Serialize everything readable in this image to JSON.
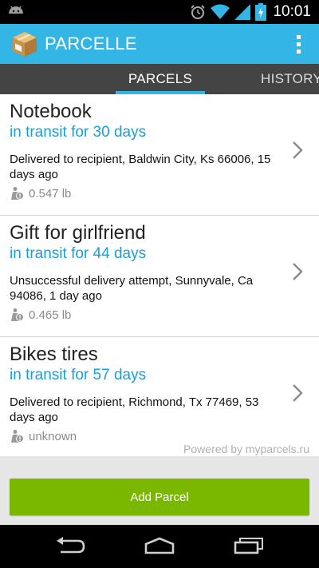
{
  "status_bar": {
    "time": "10:01",
    "icons": [
      "android-icon",
      "alarm-icon",
      "wifi-icon",
      "signal-icon",
      "battery-icon"
    ]
  },
  "action_bar": {
    "title": "PARCELLE",
    "logo_icon": "parcel-box-icon",
    "menu_icon": "overflow-menu-icon",
    "color": "#33b5e5"
  },
  "tabs": [
    {
      "label": "PARCELS",
      "selected": true
    },
    {
      "label": "HISTORY",
      "selected": false
    }
  ],
  "parcels": [
    {
      "name": "Notebook",
      "transit": "in transit for 30 days",
      "status": "Delivered to recipient, Baldwin City, Ks 66006, 15 days ago",
      "weight": "0.547 lb"
    },
    {
      "name": "Gift for girlfriend",
      "transit": "in transit for 44 days",
      "status": "Unsuccessful delivery attempt, Sunnyvale, Ca 94086, 1 day ago",
      "weight": "0.465 lb"
    },
    {
      "name": "Bikes tires",
      "transit": "in transit for 57 days",
      "status": "Delivered to recipient, Richmond, Tx 77469, 53 days ago",
      "weight": "unknown"
    }
  ],
  "powered_by": "Powered by myparcels.ru",
  "add_button": {
    "label": "Add Parcel",
    "color": "#7ab800"
  },
  "nav_bar": {
    "icons": [
      "back-icon",
      "home-icon",
      "recents-icon"
    ]
  },
  "colors": {
    "accent": "#33b5e5",
    "transit_text": "#1a9ed9"
  }
}
